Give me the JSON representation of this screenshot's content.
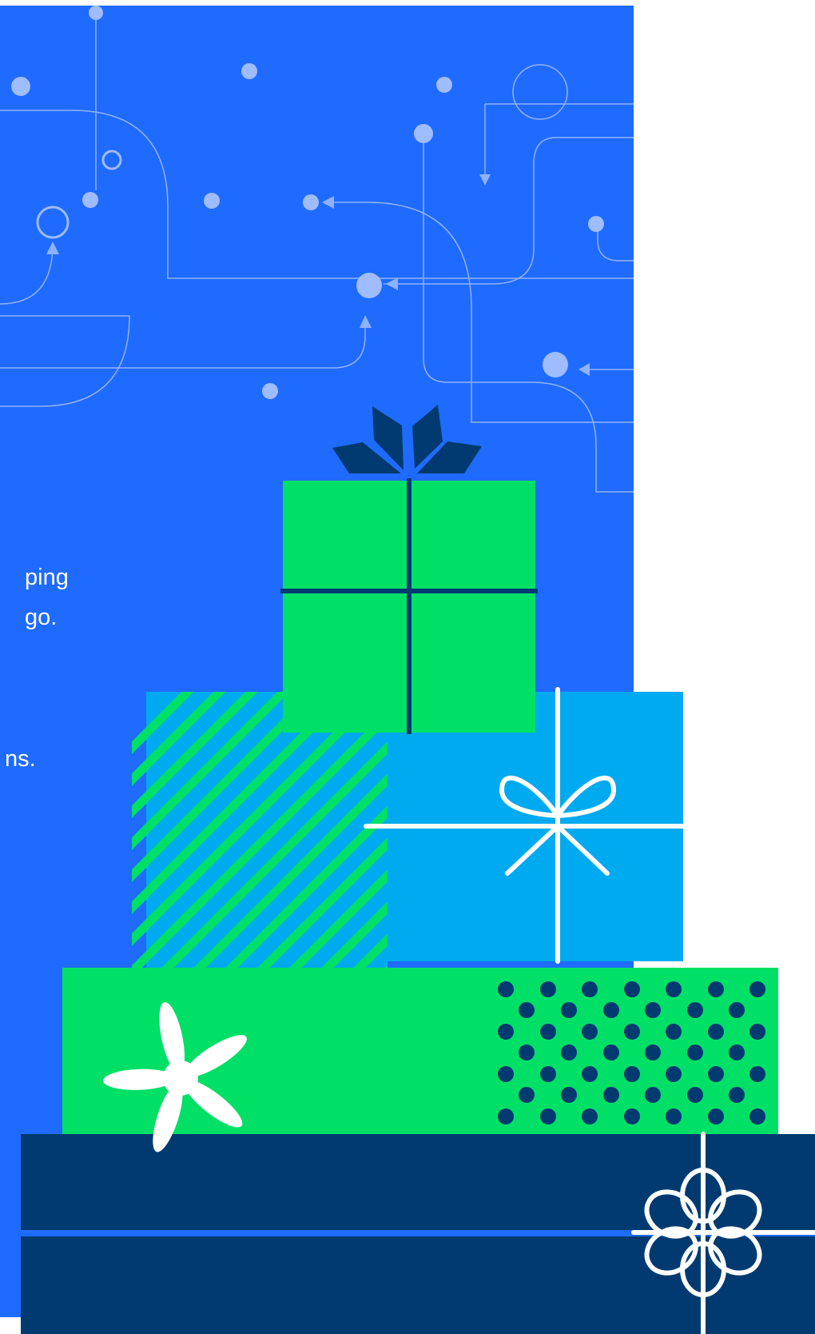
{
  "colors": {
    "background": "#ffffff",
    "panel_blue": "#1f6bff",
    "line_light": "#8fb2ff",
    "dot_light": "#9fbcff",
    "gift_green": "#00e066",
    "gift_sky": "#00aaf0",
    "navy": "#003a70",
    "white": "#ffffff"
  },
  "text_fragments": [
    "ping",
    "go.",
    "ns."
  ],
  "icons": [
    "network-lines-pattern",
    "gift-stack-illustration",
    "bow-icon",
    "ribbon-bow-icon",
    "flower-bow-icon",
    "asterisk-flower-icon"
  ]
}
